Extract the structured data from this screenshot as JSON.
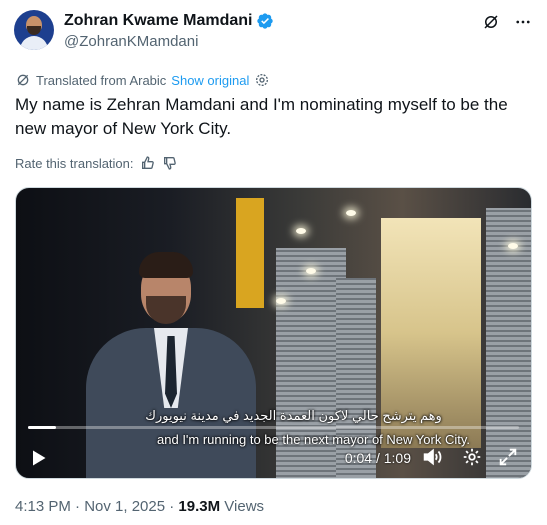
{
  "author": {
    "display_name": "Zohran Kwame Mamdani",
    "handle": "@ZohranKMamdani"
  },
  "translation": {
    "note": "Translated from Arabic",
    "show_original": "Show original",
    "rate_label": "Rate this translation:"
  },
  "tweet": {
    "text": "My name is Zehran Mamdani and I'm nominating myself to be the new mayor of New York City."
  },
  "video": {
    "subtitle_arabic": "وهم يترشح حالي لاكون العمدة الجديد في مدينة نيويورك",
    "subtitle_english": "and I'm running to be the next mayor of New York City.",
    "time": "0:04 / 1:09",
    "progress_fraction": 0.058
  },
  "footer": {
    "timestamp": "4:13 PM · Nov 1, 2025 · ",
    "views_count": "19.3M",
    "views_label": " Views"
  },
  "colors": {
    "accent": "#1d9bf0",
    "text_secondary": "#536471"
  },
  "icons": [
    "verified-badge-icon",
    "grok-icon",
    "more-icon",
    "translate-icon",
    "settings-icon",
    "thumbs-up-icon",
    "thumbs-down-icon",
    "play-icon",
    "volume-icon",
    "settings-icon",
    "fullscreen-icon"
  ]
}
